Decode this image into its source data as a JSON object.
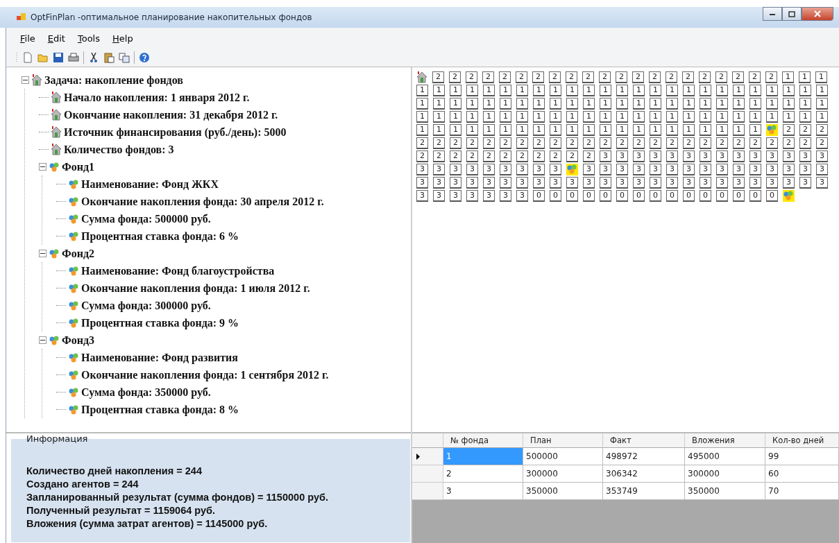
{
  "window": {
    "title": "OptFinPlan -оптимальное планирование накопительных фондов"
  },
  "menu": [
    {
      "label": "File"
    },
    {
      "label": "Edit"
    },
    {
      "label": "Tools"
    },
    {
      "label": "Help"
    }
  ],
  "toolbar": [
    {
      "kind": "new"
    },
    {
      "kind": "open"
    },
    {
      "kind": "save"
    },
    {
      "kind": "print"
    },
    {
      "kind": "sep"
    },
    {
      "kind": "cut"
    },
    {
      "kind": "paste"
    },
    {
      "kind": "copy"
    },
    {
      "kind": "sep"
    },
    {
      "kind": "help"
    }
  ],
  "tree": [
    {
      "label": "Задача: накопление фондов",
      "kind": "house",
      "expanded": true,
      "children": [
        {
          "label": "Начало накопления: 1 января 2012 г.",
          "kind": "house"
        },
        {
          "label": "Окончание накопления: 31 декабря 2012 г.",
          "kind": "house"
        },
        {
          "label": "Источник финансирования (руб./день): 5000",
          "kind": "house"
        },
        {
          "label": "Количество фондов: 3",
          "kind": "house"
        },
        {
          "label": "Фонд1",
          "kind": "fund",
          "expanded": true,
          "children": [
            {
              "label": "Наименование: Фонд ЖКХ",
              "kind": "fund"
            },
            {
              "label": "Окончание накопления фонда: 30 апреля 2012 г.",
              "kind": "fund"
            },
            {
              "label": "Сумма фонда: 500000 руб.",
              "kind": "fund"
            },
            {
              "label": "Процентная ставка фонда: 6 %",
              "kind": "fund"
            }
          ]
        },
        {
          "label": "Фонд2",
          "kind": "fund",
          "expanded": true,
          "children": [
            {
              "label": "Наименование: Фонд благоустройства",
              "kind": "fund"
            },
            {
              "label": "Окончание накопления фонда: 1 июля 2012 г.",
              "kind": "fund"
            },
            {
              "label": "Сумма фонда: 300000 руб.",
              "kind": "fund"
            },
            {
              "label": "Процентная ставка фонда: 9 %",
              "kind": "fund"
            }
          ]
        },
        {
          "label": "Фонд3",
          "kind": "fund",
          "expanded": true,
          "children": [
            {
              "label": "Наименование: Фонд развития",
              "kind": "fund"
            },
            {
              "label": "Окончание накопления фонда: 1 сентября 2012 г.",
              "kind": "fund"
            },
            {
              "label": "Сумма фонда: 350000 руб.",
              "kind": "fund"
            },
            {
              "label": "Процентная ставка фонда: 8 %",
              "kind": "fund"
            }
          ]
        }
      ]
    }
  ],
  "agent_grid": [
    [
      {
        "kind": "house"
      },
      "2",
      "2",
      "2",
      "2",
      "2",
      "2",
      "2",
      "2",
      "2",
      "2",
      "2",
      "2",
      "2",
      "2",
      "2",
      "2",
      "2",
      "2",
      "2",
      "2",
      "2",
      "1",
      "1",
      "1"
    ],
    [
      "1",
      "1",
      "1",
      "1",
      "1",
      "1",
      "1",
      "1",
      "1",
      "1",
      "1",
      "1",
      "1",
      "1",
      "1",
      "1",
      "1",
      "1",
      "1",
      "1",
      "1",
      "1",
      "1",
      "1",
      "1"
    ],
    [
      "1",
      "1",
      "1",
      "1",
      "1",
      "1",
      "1",
      "1",
      "1",
      "1",
      "1",
      "1",
      "1",
      "1",
      "1",
      "1",
      "1",
      "1",
      "1",
      "1",
      "1",
      "1",
      "1",
      "1",
      "1"
    ],
    [
      "1",
      "1",
      "1",
      "1",
      "1",
      "1",
      "1",
      "1",
      "1",
      "1",
      "1",
      "1",
      "1",
      "1",
      "1",
      "1",
      "1",
      "1",
      "1",
      "1",
      "1",
      "1",
      "1",
      "1",
      "1"
    ],
    [
      "1",
      "1",
      "1",
      "1",
      "1",
      "1",
      "1",
      "1",
      "1",
      "1",
      "1",
      "1",
      "1",
      "1",
      "1",
      "1",
      "1",
      "1",
      "1",
      "1",
      "1",
      {
        "kind": "fund"
      },
      "2",
      "2",
      "2"
    ],
    [
      "2",
      "2",
      "2",
      "2",
      "2",
      "2",
      "2",
      "2",
      "2",
      "2",
      "2",
      "2",
      "2",
      "2",
      "2",
      "2",
      "2",
      "2",
      "2",
      "2",
      "2",
      "2",
      "2",
      "2",
      "2"
    ],
    [
      "2",
      "2",
      "2",
      "2",
      "2",
      "2",
      "2",
      "2",
      "2",
      "2",
      "2",
      "3",
      "3",
      "3",
      "3",
      "3",
      "3",
      "3",
      "3",
      "3",
      "3",
      "3",
      "3",
      "3",
      "3"
    ],
    [
      "3",
      "3",
      "3",
      "3",
      "3",
      "3",
      "3",
      "3",
      "3",
      {
        "kind": "fund"
      },
      "3",
      "3",
      "3",
      "3",
      "3",
      "3",
      "3",
      "3",
      "3",
      "3",
      "3",
      "3",
      "3",
      "3",
      "3"
    ],
    [
      "3",
      "3",
      "3",
      "3",
      "3",
      "3",
      "3",
      "3",
      "3",
      "3",
      "3",
      "3",
      "3",
      "3",
      "3",
      "3",
      "3",
      "3",
      "3",
      "3",
      "3",
      "3",
      "3",
      "3",
      "3"
    ],
    [
      "3",
      "3",
      "3",
      "3",
      "3",
      "3",
      "3",
      "0",
      "0",
      "0",
      "0",
      "0",
      "0",
      "0",
      "0",
      "0",
      "0",
      "0",
      "0",
      "0",
      "0",
      "0",
      {
        "kind": "fund"
      }
    ]
  ],
  "info": {
    "title": "Информация",
    "lines": [
      "Количество дней накопления = 244",
      "Создано агентов = 244",
      "Запланированный результат (сумма фондов) = 1150000 руб.",
      "Полученный результат = 1159064 руб.",
      "Вложения (сумма затрат агентов) = 1145000 руб."
    ]
  },
  "table": {
    "columns": [
      "№ фонда",
      "План",
      "Факт",
      "Вложения",
      "Кол-во дней"
    ],
    "rows": [
      {
        "selected": true,
        "cells": [
          "1",
          "500000",
          "498972",
          "495000",
          "99"
        ]
      },
      {
        "selected": false,
        "cells": [
          "2",
          "300000",
          "306342",
          "300000",
          "60"
        ]
      },
      {
        "selected": false,
        "cells": [
          "3",
          "350000",
          "353749",
          "350000",
          "70"
        ]
      }
    ]
  }
}
